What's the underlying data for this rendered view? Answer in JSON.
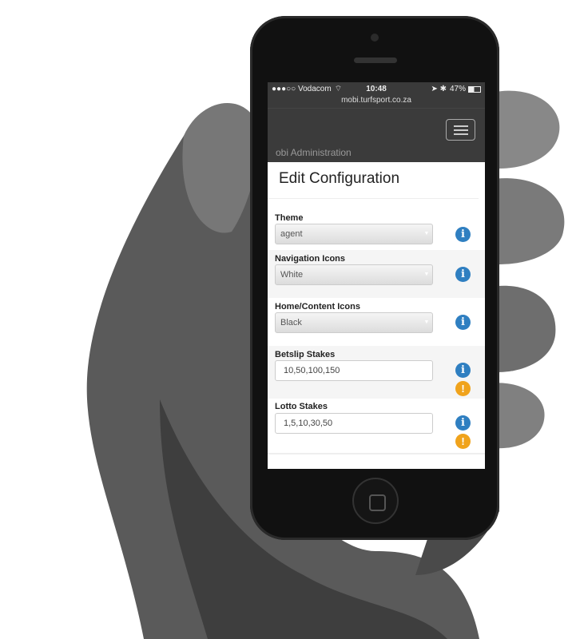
{
  "status_bar": {
    "carrier": "●●●○○ Vodacom",
    "time": "10:48",
    "battery": "47%",
    "url": "mobi.turfsport.co.za"
  },
  "nav": {
    "brand": "Mobi Administration",
    "menu_icon": "hamburger-icon"
  },
  "page": {
    "title": "Edit Configuration"
  },
  "fields": [
    {
      "label": "Theme",
      "type": "select",
      "value": "agent"
    },
    {
      "label": "Navigation Icons",
      "type": "select",
      "value": "White"
    },
    {
      "label": "Home/Content Icons",
      "type": "select",
      "value": "Black"
    },
    {
      "label": "Betslip Stakes",
      "type": "text",
      "value": "10,50,100,150"
    },
    {
      "label": "Lotto Stakes",
      "type": "text",
      "value": "1,5,10,30,50"
    }
  ],
  "colors": {
    "info": "#2f7fc1",
    "warning": "#f0a31c",
    "navbar": "#3b3b3b"
  }
}
